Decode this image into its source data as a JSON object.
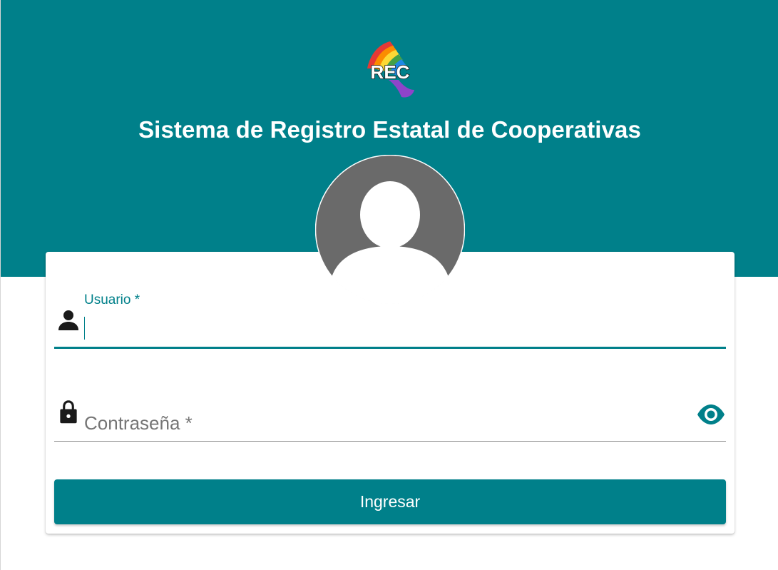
{
  "header": {
    "title": "Sistema de Registro Estatal de Cooperativas",
    "logo_text": "REC",
    "background_color": "#00808a"
  },
  "login_form": {
    "username": {
      "label": "Usuario *",
      "value": "",
      "icon": "person-icon"
    },
    "password": {
      "placeholder": "Contraseña *",
      "value": "",
      "icon": "lock-icon",
      "toggle_icon": "eye-icon"
    },
    "submit_label": "Ingresar",
    "avatar_icon": "default-avatar-icon"
  },
  "colors": {
    "accent": "#00808a",
    "avatar_gray": "#6a6a6a",
    "icon_dark": "#1a1a1a"
  }
}
